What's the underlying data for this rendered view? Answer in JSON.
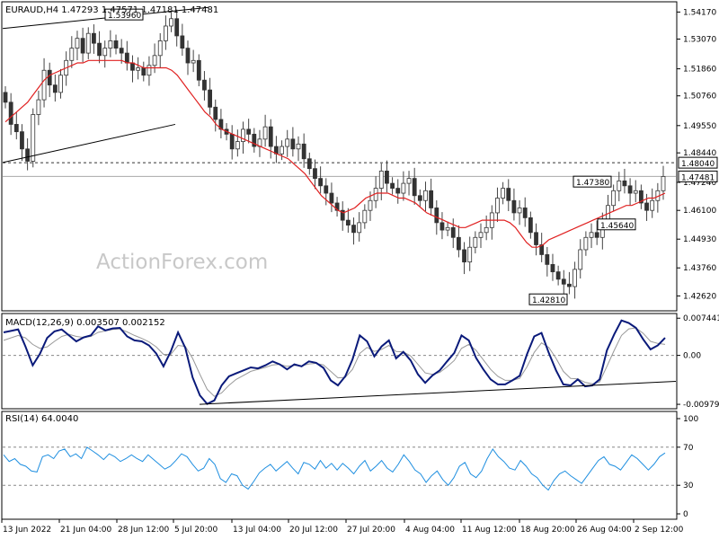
{
  "chart_data": [
    {
      "type": "candlestick",
      "title": "EURAUD,H4  1.47293 1.47571 1.47181 1.47481",
      "watermark": "ActionForex.com",
      "price_axis_ticks": [
        "1.54170",
        "1.53070",
        "1.51860",
        "1.50760",
        "1.49550",
        "1.48440",
        "1.47240",
        "1.46100",
        "1.44930",
        "1.43760",
        "1.42620"
      ],
      "ylim": [
        1.4205,
        1.5455
      ],
      "current_price": {
        "label": "1.47481",
        "value": 1.47481
      },
      "level_line": {
        "label": "1.48040",
        "value": 1.4804
      },
      "annotations": [
        {
          "label": "1.53960",
          "value": 1.5396
        },
        {
          "label": "1.47380",
          "value": 1.4738
        },
        {
          "label": "1.45640",
          "value": 1.4564
        },
        {
          "label": "1.42810",
          "value": 1.4281
        }
      ],
      "close_series": [
        1.505,
        1.496,
        1.493,
        1.486,
        1.481,
        1.5,
        1.506,
        1.518,
        1.512,
        1.509,
        1.516,
        1.522,
        1.527,
        1.531,
        1.525,
        1.533,
        1.529,
        1.524,
        1.527,
        1.53,
        1.527,
        1.525,
        1.521,
        1.518,
        1.519,
        1.516,
        1.52,
        1.524,
        1.53,
        1.536,
        1.539,
        1.532,
        1.527,
        1.521,
        1.522,
        1.514,
        1.51,
        1.503,
        1.498,
        1.494,
        1.492,
        1.486,
        1.489,
        1.494,
        1.492,
        1.487,
        1.49,
        1.495,
        1.487,
        1.484,
        1.487,
        1.49,
        1.486,
        1.488,
        1.482,
        1.478,
        1.474,
        1.471,
        1.468,
        1.464,
        1.461,
        1.457,
        1.455,
        1.452,
        1.456,
        1.461,
        1.465,
        1.47,
        1.477,
        1.472,
        1.47,
        1.468,
        1.472,
        1.474,
        1.467,
        1.465,
        1.469,
        1.462,
        1.456,
        1.453,
        1.454,
        1.45,
        1.445,
        1.44,
        1.446,
        1.45,
        1.452,
        1.454,
        1.46,
        1.466,
        1.47,
        1.465,
        1.46,
        1.462,
        1.458,
        1.452,
        1.447,
        1.443,
        1.439,
        1.436,
        1.433,
        1.431,
        1.43,
        1.437,
        1.445,
        1.45,
        1.452,
        1.45,
        1.457,
        1.463,
        1.469,
        1.473,
        1.471,
        1.468,
        1.469,
        1.464,
        1.461,
        1.465,
        1.469,
        1.4748
      ],
      "moving_average": [
        1.497,
        1.499,
        1.501,
        1.503,
        1.505,
        1.508,
        1.511,
        1.514,
        1.516,
        1.517,
        1.518,
        1.519,
        1.52,
        1.521,
        1.521,
        1.522,
        1.522,
        1.522,
        1.522,
        1.522,
        1.522,
        1.522,
        1.521,
        1.521,
        1.52,
        1.519,
        1.519,
        1.519,
        1.519,
        1.519,
        1.518,
        1.516,
        1.513,
        1.51,
        1.507,
        1.504,
        1.501,
        1.499,
        1.496,
        1.494,
        1.493,
        1.492,
        1.491,
        1.49,
        1.489,
        1.488,
        1.487,
        1.486,
        1.485,
        1.484,
        1.483,
        1.482,
        1.48,
        1.478,
        1.476,
        1.473,
        1.47,
        1.467,
        1.465,
        1.463,
        1.461,
        1.46,
        1.461,
        1.462,
        1.464,
        1.466,
        1.467,
        1.468,
        1.468,
        1.468,
        1.467,
        1.466,
        1.466,
        1.465,
        1.464,
        1.462,
        1.46,
        1.459,
        1.458,
        1.457,
        1.456,
        1.455,
        1.454,
        1.454,
        1.455,
        1.456,
        1.457,
        1.457,
        1.457,
        1.457,
        1.457,
        1.456,
        1.454,
        1.451,
        1.448,
        1.446,
        1.446,
        1.447,
        1.449,
        1.45,
        1.451,
        1.452,
        1.453,
        1.454,
        1.455,
        1.456,
        1.457,
        1.458,
        1.459,
        1.46,
        1.461,
        1.462,
        1.463,
        1.463,
        1.464,
        1.465,
        1.466,
        1.466,
        1.467,
        1.468
      ],
      "x_tick_labels": [
        "13 Jun 2022",
        "21 Jun 04:00",
        "28 Jun 12:00",
        "5 Jul 20:00",
        "13 Jul 04:00",
        "20 Jul 12:00",
        "27 Jul 20:00",
        "4 Aug 04:00",
        "11 Aug 12:00",
        "18 Aug 20:00",
        "26 Aug 04:00",
        "2 Sep 12:00"
      ]
    },
    {
      "type": "line",
      "title": "MACD(12,26,9) 0.003507 0.002152",
      "ylim": [
        -0.0105,
        0.0082
      ],
      "y_tick_labels": [
        {
          "label": "0.007441",
          "value": 0.007441
        },
        {
          "label": "0.00",
          "value": 0.0
        },
        {
          "label": "-0.009794",
          "value": -0.009794
        }
      ],
      "macd": [
        0.0046,
        0.0049,
        0.0052,
        0.0018,
        -0.002,
        0.0003,
        0.0035,
        0.0048,
        0.0052,
        0.004,
        0.0028,
        0.0036,
        0.004,
        0.0058,
        0.005,
        0.0054,
        0.0055,
        0.0038,
        0.003,
        0.0028,
        0.002,
        0.0004,
        -0.0022,
        0.0008,
        0.0046,
        0.0015,
        -0.0044,
        -0.008,
        -0.0097,
        -0.009,
        -0.006,
        -0.0042,
        -0.0036,
        -0.003,
        -0.0024,
        -0.0026,
        -0.002,
        -0.0012,
        -0.0018,
        -0.0028,
        -0.0018,
        -0.0022,
        -0.0012,
        -0.0015,
        -0.0025,
        -0.005,
        -0.006,
        -0.0042,
        -0.0008,
        0.004,
        0.0028,
        -0.0002,
        0.0018,
        0.003,
        -0.0006,
        0.0007,
        -0.001,
        -0.0038,
        -0.0055,
        -0.004,
        -0.003,
        -0.0012,
        0.0005,
        0.004,
        0.003,
        -0.0005,
        -0.0028,
        -0.0048,
        -0.0058,
        -0.0058,
        -0.005,
        -0.0041,
        0.0002,
        0.0038,
        0.0045,
        0.0005,
        -0.003,
        -0.0058,
        -0.006,
        -0.0048,
        -0.0062,
        -0.006,
        -0.0048,
        0.001,
        0.0042,
        0.007,
        0.0065,
        0.0055,
        0.0032,
        0.0012,
        0.002,
        0.0035
      ],
      "signal": [
        0.003,
        0.0035,
        0.004,
        0.0035,
        0.0022,
        0.0014,
        0.0017,
        0.0028,
        0.0038,
        0.0042,
        0.0038,
        0.0036,
        0.0038,
        0.0046,
        0.0049,
        0.0052,
        0.0053,
        0.0047,
        0.004,
        0.0034,
        0.0027,
        0.0017,
        0.0002,
        0.0002,
        0.002,
        0.0018,
        -0.0006,
        -0.0038,
        -0.0068,
        -0.0082,
        -0.0075,
        -0.006,
        -0.0048,
        -0.004,
        -0.0032,
        -0.0028,
        -0.0024,
        -0.0019,
        -0.0018,
        -0.0022,
        -0.002,
        -0.0021,
        -0.0017,
        -0.0016,
        -0.0019,
        -0.0032,
        -0.0045,
        -0.0044,
        -0.0028,
        0.0004,
        0.0016,
        0.0008,
        0.0012,
        0.002,
        0.0008,
        0.0007,
        -0.0001,
        -0.0018,
        -0.0035,
        -0.0038,
        -0.0034,
        -0.0023,
        -0.001,
        0.0014,
        0.0022,
        0.001,
        -0.0009,
        -0.0028,
        -0.0042,
        -0.005,
        -0.005,
        -0.0046,
        -0.0023,
        0.0006,
        0.0025,
        0.0016,
        -0.0006,
        -0.0032,
        -0.0046,
        -0.0047,
        -0.0054,
        -0.0057,
        -0.0053,
        -0.0022,
        0.001,
        0.004,
        0.0053,
        0.0055,
        0.0044,
        0.0028,
        0.0024,
        0.0022
      ],
      "trendline": [
        [
          -0.0097,
          0.0
        ],
        [
          -0.0048,
          1.0
        ]
      ]
    },
    {
      "type": "line",
      "title": "RSI(14) 64.0040",
      "ylim": [
        0,
        100
      ],
      "y_tick_labels": [
        {
          "label": "100",
          "value": 100
        },
        {
          "label": "70",
          "value": 70
        },
        {
          "label": "30",
          "value": 30
        },
        {
          "label": "0",
          "value": 0
        }
      ],
      "rsi": [
        62,
        55,
        58,
        52,
        50,
        45,
        44,
        60,
        62,
        58,
        66,
        68,
        60,
        63,
        58,
        70,
        66,
        62,
        57,
        63,
        60,
        55,
        58,
        62,
        58,
        55,
        62,
        57,
        52,
        47,
        50,
        56,
        63,
        60,
        52,
        45,
        48,
        58,
        52,
        37,
        33,
        42,
        40,
        30,
        26,
        34,
        43,
        48,
        52,
        45,
        50,
        55,
        48,
        42,
        54,
        52,
        47,
        56,
        48,
        53,
        46,
        53,
        48,
        42,
        50,
        56,
        45,
        50,
        56,
        48,
        44,
        52,
        62,
        55,
        46,
        42,
        33,
        40,
        45,
        36,
        30,
        38,
        50,
        54,
        42,
        38,
        45,
        58,
        68,
        60,
        55,
        48,
        46,
        56,
        50,
        42,
        38,
        30,
        25,
        35,
        42,
        45,
        40,
        36,
        32,
        40,
        48,
        56,
        60,
        52,
        50,
        46,
        54,
        62,
        58,
        52,
        46,
        52,
        60,
        64
      ],
      "levels": [
        70,
        30
      ]
    }
  ]
}
